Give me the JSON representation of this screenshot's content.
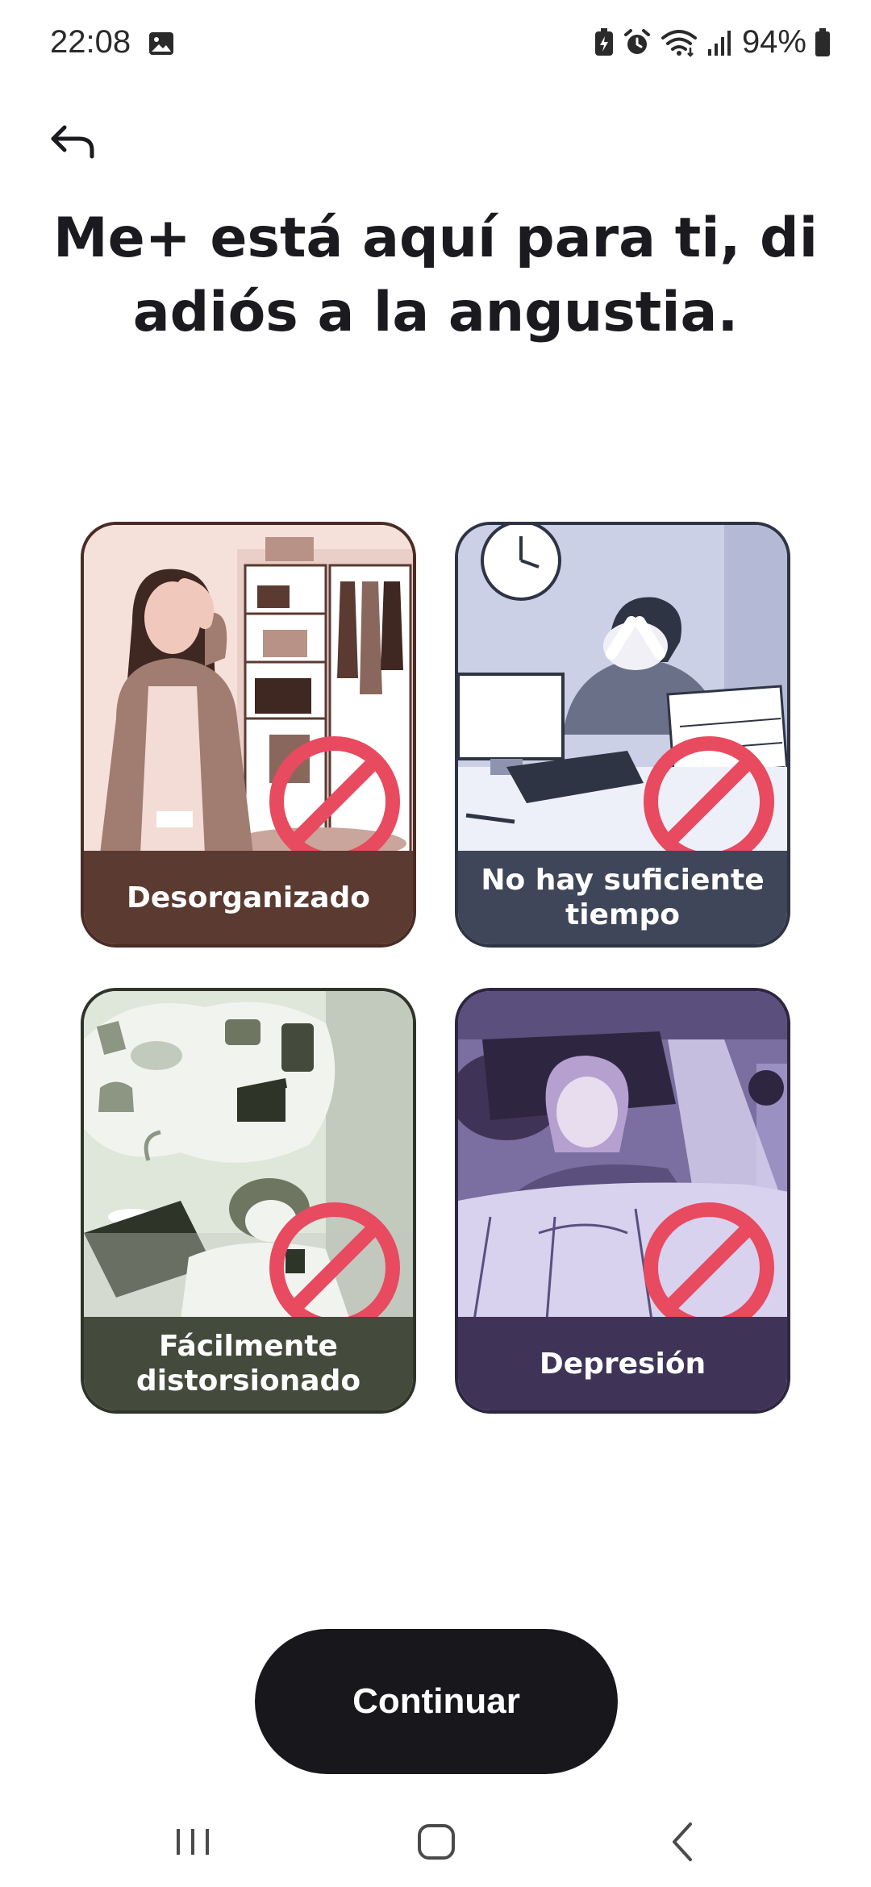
{
  "status_bar": {
    "time": "22:08",
    "battery": "94%",
    "icons": [
      "gallery-icon",
      "battery-saver-icon",
      "alarm-icon",
      "wifi-icon",
      "signal-icon",
      "battery-icon"
    ]
  },
  "header": {
    "back_icon": "back-arrow-icon"
  },
  "title": "Me+ está aquí para ti, di adiós a la angustia.",
  "cards": [
    {
      "label": "Desorganizado",
      "color": "#5a3a31",
      "illustration_bg": "#f6e0da"
    },
    {
      "label": "No hay suficiente tiempo",
      "color": "#3f4659",
      "illustration_bg": "#cbd0e6"
    },
    {
      "label": "Fácilmente distorsionado",
      "color": "#444b3d",
      "illustration_bg": "#dfe6da"
    },
    {
      "label": "Depresión",
      "color": "#3f3458",
      "illustration_bg": "#b9afd6"
    }
  ],
  "no_sign_color": "#e84a5f",
  "continue_label": "Continuar",
  "nav": [
    "recents-icon",
    "home-icon",
    "back-icon"
  ]
}
